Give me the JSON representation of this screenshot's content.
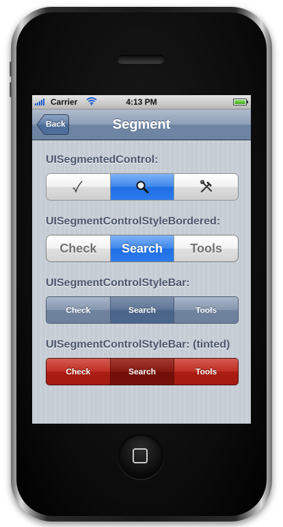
{
  "status_bar": {
    "carrier": "Carrier",
    "time": "4:13 PM",
    "signal_bars": 5,
    "battery_level": 1.0
  },
  "nav_bar": {
    "back_label": "Back",
    "title": "Segment"
  },
  "sections": {
    "default": {
      "label": "UISegmentedControl:",
      "segments": [
        "check-icon",
        "search-icon",
        "tools-icon"
      ],
      "selected_index": 1
    },
    "bordered": {
      "label": "UISegmentControlStyleBordered:",
      "segments": [
        "Check",
        "Search",
        "Tools"
      ],
      "selected_index": 1
    },
    "bar": {
      "label": "UISegmentControlStyleBar:",
      "segments": [
        "Check",
        "Search",
        "Tools"
      ],
      "selected_index": 1
    },
    "tinted": {
      "label": "UISegmentControlStyleBar: (tinted)",
      "segments": [
        "Check",
        "Search",
        "Tools"
      ],
      "selected_index": 1
    }
  },
  "colors": {
    "selected_blue": "#2b7bed",
    "bar_blue": "#6d819d",
    "tint_red": "#a41b11",
    "nav_bar": "#6d84a2",
    "background": "#c5ccd4"
  }
}
